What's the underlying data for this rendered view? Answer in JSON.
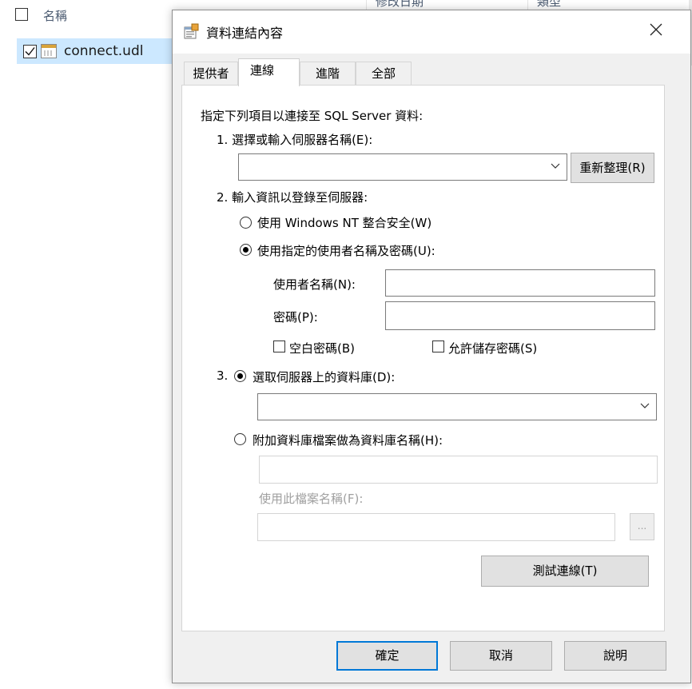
{
  "explorer": {
    "columns": [
      "名稱",
      "修改日期",
      "類型"
    ],
    "file_name": "connect.udl"
  },
  "dialog": {
    "title": "資料連結內容",
    "tabs": [
      "提供者",
      "連線",
      "進階",
      "全部"
    ],
    "active_tab": "連線",
    "intro": "指定下列項目以連接至 SQL Server 資料:",
    "step1_label": "1. 選擇或輸入伺服器名稱(E):",
    "server_name_value": "",
    "refresh_button": "重新整理(R)",
    "step2_label": "2. 輸入資訊以登錄至伺服器:",
    "radio_nt_security": "使用 Windows NT 整合安全(W)",
    "radio_specific_user": "使用指定的使用者名稱及密碼(U):",
    "username_label": "使用者名稱(N):",
    "username_value": "",
    "password_label": "密碼(P):",
    "password_value": "",
    "blank_password_label": "空白密碼(B)",
    "allow_save_password_label": "允許儲存密碼(S)",
    "step3_number": "3.",
    "radio_select_database": "選取伺服器上的資料庫(D):",
    "database_value": "",
    "radio_attach_db_file": "附加資料庫檔案做為資料庫名稱(H):",
    "attach_db_value": "",
    "use_filename_label": "使用此檔案名稱(F):",
    "filename_value": "",
    "browse_button": "...",
    "test_connection_button": "測試連線(T)",
    "ok_button": "確定",
    "cancel_button": "取消",
    "help_button": "說明"
  },
  "colors": {
    "selection": "#cce8ff",
    "default_button_border": "#0078d7",
    "dialog_background": "#f0f0f0"
  }
}
